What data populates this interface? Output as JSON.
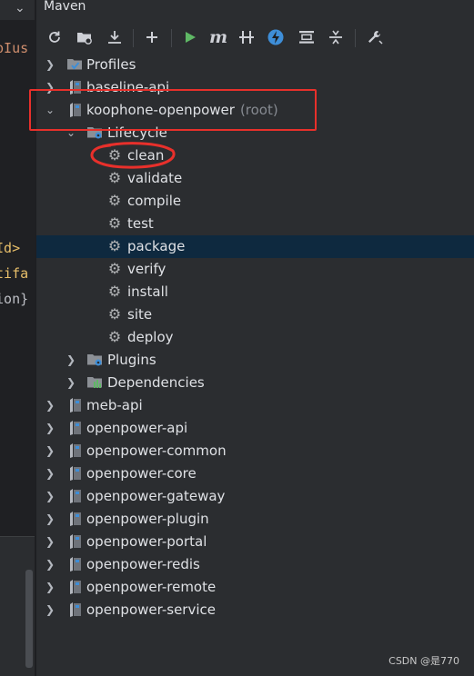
{
  "panel": {
    "title": "Maven"
  },
  "toolbar": {
    "buttons": [
      {
        "name": "reload-icon"
      },
      {
        "name": "generate-sources-icon"
      },
      {
        "name": "download-icon"
      },
      {
        "name": "add-icon"
      },
      {
        "name": "run-icon"
      },
      {
        "name": "execute-goal-icon"
      },
      {
        "name": "toggle-offline-icon"
      },
      {
        "name": "skip-tests-icon"
      },
      {
        "name": "show-dependencies-icon"
      },
      {
        "name": "collapse-all-icon"
      },
      {
        "name": "settings-wrench-icon"
      }
    ]
  },
  "editor": {
    "lines": [
      {
        "text": "opIus",
        "color": "#cf8e6d"
      },
      {
        "text": "oId>",
        "color": "#e8bf6a"
      },
      {
        "text": "rtifa",
        "color": "#e8bf6a"
      },
      {
        "text": "sion}",
        "color": "#bcbec4"
      }
    ]
  },
  "tree": {
    "profiles": "Profiles",
    "baseline": "baseline-api",
    "root_project": "koophone-openpower",
    "root_suffix": "(root)",
    "lifecycle": "Lifecycle",
    "lifecycle_items": [
      "clean",
      "validate",
      "compile",
      "test",
      "package",
      "verify",
      "install",
      "site",
      "deploy"
    ],
    "plugins": "Plugins",
    "dependencies": "Dependencies",
    "modules": [
      "meb-api",
      "openpower-api",
      "openpower-common",
      "openpower-core",
      "openpower-gateway",
      "openpower-plugin",
      "openpower-portal",
      "openpower-redis",
      "openpower-remote",
      "openpower-service"
    ]
  },
  "watermark": "CSDN @是770",
  "colors": {
    "selected_row": "#0e293f",
    "annotation_red": "#e8302b",
    "run_green": "#5fb865",
    "sync_blue": "#3e8ed8"
  }
}
